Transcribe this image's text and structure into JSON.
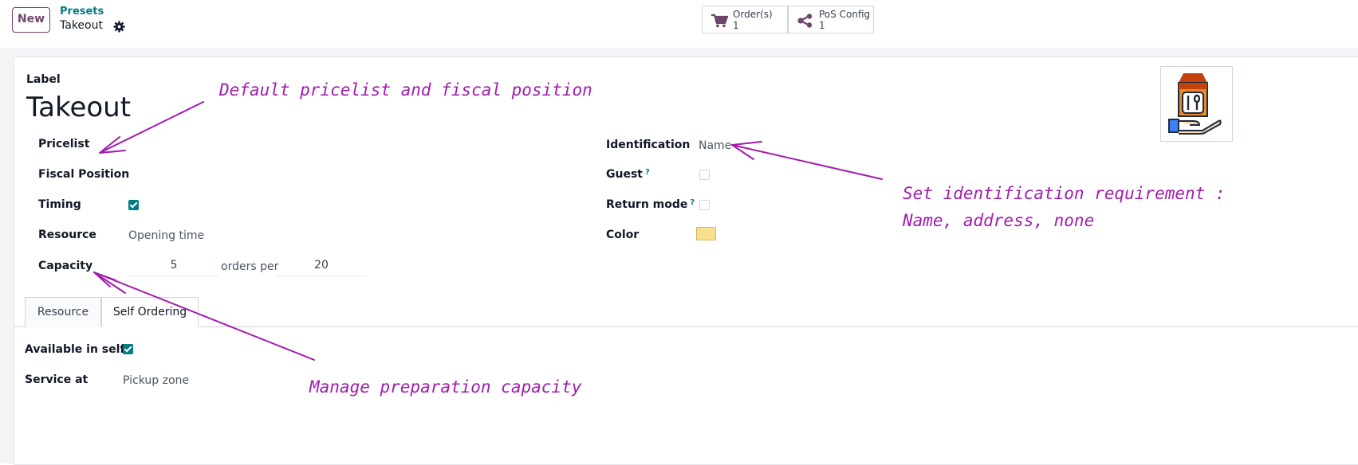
{
  "toolbar": {
    "new_label": "New"
  },
  "breadcrumb": {
    "parent": "Presets",
    "current": "Takeout"
  },
  "smart_buttons": [
    {
      "label": "Order(s)",
      "value": "1",
      "icon": "cart-icon"
    },
    {
      "label": "PoS Config",
      "value": "1",
      "icon": "share-icon"
    }
  ],
  "form": {
    "label_caption": "Label",
    "title": "Takeout",
    "pricelist_label": "Pricelist",
    "fiscal_position_label": "Fiscal Position",
    "timing_label": "Timing",
    "timing_checked": true,
    "resource_label": "Resource",
    "resource_value": "Opening time",
    "capacity_label": "Capacity",
    "capacity_orders": "5",
    "capacity_middle": "orders per",
    "capacity_per": "20",
    "identification_label": "Identification",
    "identification_value": "Name",
    "guest_label": "Guest",
    "guest_help": "?",
    "guest_checked": false,
    "return_mode_label": "Return mode",
    "return_mode_help": "?",
    "return_mode_checked": false,
    "color_label": "Color",
    "color_value": "#f8e08e"
  },
  "tabs": [
    {
      "label": "Resource",
      "active": false
    },
    {
      "label": "Self Ordering",
      "active": true
    }
  ],
  "self_ordering": {
    "available_label": "Available in self",
    "available_checked": true,
    "service_label": "Service at",
    "service_value": "Pickup zone"
  },
  "annotations": {
    "pricelist_note": "Default pricelist and fiscal position",
    "identification_note_line1": "Set identification requirement :",
    "identification_note_line2": "Name, address, none",
    "capacity_note": "Manage preparation capacity"
  },
  "colors": {
    "brand": "#71456a",
    "accent": "#017e84",
    "annotation": "#a21caf"
  }
}
